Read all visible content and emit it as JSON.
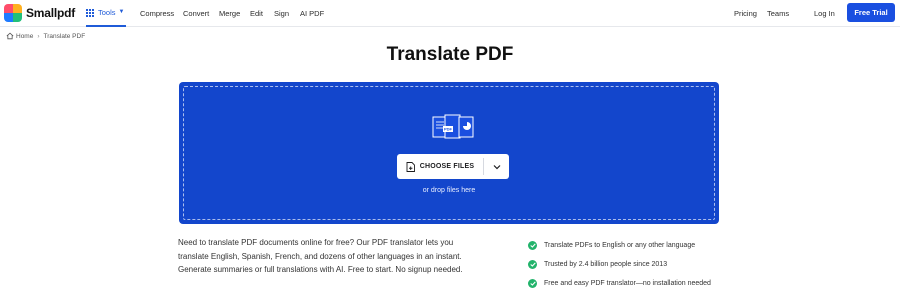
{
  "brand": {
    "name": "Smallpdf"
  },
  "nav": {
    "tools": "Tools",
    "compress": "Compress",
    "convert": "Convert",
    "merge": "Merge",
    "edit": "Edit",
    "sign": "Sign",
    "ai_pdf": "AI PDF",
    "pricing": "Pricing",
    "teams": "Teams",
    "login": "Log In",
    "free_trial": "Free Trial"
  },
  "breadcrumb": {
    "home": "Home",
    "current": "Translate PDF"
  },
  "page": {
    "title": "Translate PDF"
  },
  "dropzone": {
    "choose_files": "CHOOSE FILES",
    "drop_hint": "or drop files here",
    "background_color": "#1346cc"
  },
  "description": {
    "line1": "Need to translate PDF documents online for free? Our PDF translator lets you",
    "line2": "translate English, Spanish, French, and dozens of other languages in an instant.",
    "line3": "Generate summaries or full translations with AI. Free to start. No signup needed."
  },
  "features": [
    {
      "label": "Translate PDFs to English or any other language"
    },
    {
      "label": "Trusted by 2.4 billion people since 2013"
    },
    {
      "label": "Free and easy PDF translator—no installation needed"
    }
  ],
  "colors": {
    "accent": "#1a4fe0",
    "check": "#22b36b"
  }
}
